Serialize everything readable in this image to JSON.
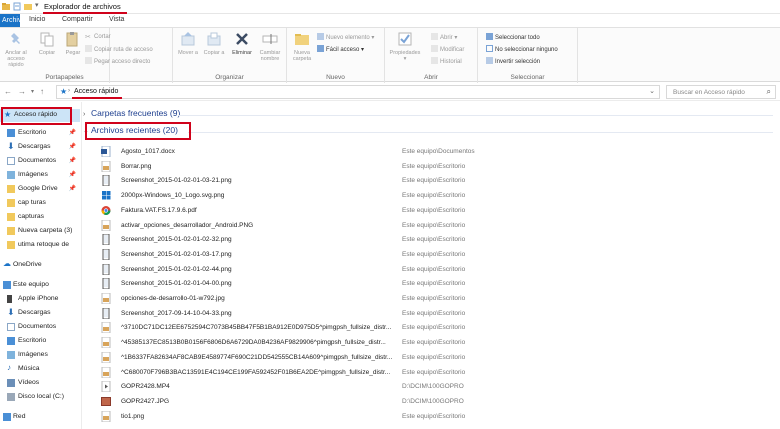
{
  "window": {
    "title": "Explorador de archivos"
  },
  "tabs": [
    "Archivo",
    "Inicio",
    "Compartir",
    "Vista"
  ],
  "ribbon": {
    "portapapeles": {
      "label": "Portapapeles",
      "anclar": "Anclar al acceso rápido",
      "copiar": "Copiar",
      "pegar": "Pegar",
      "cortar": "Cortar",
      "copiar_ruta": "Copiar ruta de acceso",
      "pegar_acceso": "Pegar acceso directo"
    },
    "organizar": {
      "label": "Organizar",
      "mover": "Mover a",
      "copiar_a": "Copiar a",
      "eliminar": "Eliminar",
      "cambiar": "Cambiar nombre"
    },
    "nuevo": {
      "label": "Nuevo",
      "carpeta": "Nueva carpeta",
      "elemento": "Nuevo elemento",
      "facil": "Fácil acceso"
    },
    "abrir": {
      "label": "Abrir",
      "propiedades": "Propiedades",
      "abrir": "Abrir",
      "modificar": "Modificar",
      "historial": "Historial"
    },
    "seleccionar": {
      "label": "Seleccionar",
      "todo": "Seleccionar todo",
      "ninguno": "No seleccionar ninguno",
      "invertir": "Invertir selección"
    }
  },
  "address": {
    "path": "Acceso rápido",
    "search_placeholder": "Buscar en Acceso rápido"
  },
  "nav": {
    "quick_access": "Acceso rápido",
    "items": [
      "Escritorio",
      "Descargas",
      "Documentos",
      "Imágenes",
      "Google Drive",
      "cap turas",
      "capturas",
      "Nueva carpeta (3)",
      "utima retoque de"
    ],
    "onedrive": "OneDrive",
    "este_equipo": "Este equipo",
    "pc_items": [
      "Apple iPhone",
      "Descargas",
      "Documentos",
      "Escritorio",
      "Imágenes",
      "Música",
      "Vídeos",
      "Disco local (C:)"
    ],
    "red": "Red"
  },
  "groups": {
    "frecuentes": "Carpetas frecuentes (9)",
    "recientes": "Archivos recientes (20)"
  },
  "files": [
    {
      "name": "Agosto_1017.docx",
      "path": "Este equipo\\Documentos",
      "icon": "word-doc-icon"
    },
    {
      "name": "Borrar.png",
      "path": "Este equipo\\Escritorio",
      "icon": "image-file-icon"
    },
    {
      "name": "Screenshot_2015-01-02-01-03-21.png",
      "path": "Este equipo\\Escritorio",
      "icon": "phone-screenshot-icon"
    },
    {
      "name": "2000px-Windows_10_Logo.svg.png",
      "path": "Este equipo\\Escritorio",
      "icon": "windows-logo-icon"
    },
    {
      "name": "Faktura.VAT.FS.17.9.6.pdf",
      "path": "Este equipo\\Escritorio",
      "icon": "chrome-pdf-icon"
    },
    {
      "name": "activar_opciones_desarrollador_Android.PNG",
      "path": "Este equipo\\Escritorio",
      "icon": "image-file-icon"
    },
    {
      "name": "Screenshot_2015-01-02-01-02-32.png",
      "path": "Este equipo\\Escritorio",
      "icon": "phone-screenshot-icon"
    },
    {
      "name": "Screenshot_2015-01-02-01-03-17.png",
      "path": "Este equipo\\Escritorio",
      "icon": "phone-screenshot-icon"
    },
    {
      "name": "Screenshot_2015-01-02-01-02-44.png",
      "path": "Este equipo\\Escritorio",
      "icon": "phone-screenshot-icon"
    },
    {
      "name": "Screenshot_2015-01-02-01-04-00.png",
      "path": "Este equipo\\Escritorio",
      "icon": "phone-screenshot-icon"
    },
    {
      "name": "opciones-de-desarrollo-01-w792.jpg",
      "path": "Este equipo\\Escritorio",
      "icon": "image-file-icon"
    },
    {
      "name": "Screenshot_2017-09-14-10-04-33.png",
      "path": "Este equipo\\Escritorio",
      "icon": "phone-screenshot-icon"
    },
    {
      "name": "^3710DC71DC12EE6752594C7073B45BB47F5B1BA912E0D975D5^pimgpsh_fullsize_distr...",
      "path": "Este equipo\\Escritorio",
      "icon": "image-file-icon"
    },
    {
      "name": "^45385137EC8513B0B0156F6806D6A6729DA0B4236AF9829906^pimgpsh_fullsize_distr...",
      "path": "Este equipo\\Escritorio",
      "icon": "image-file-icon"
    },
    {
      "name": "^1B6337FA82634AF8CAB9E4589774F690C21DD542555CB14A609^pimgpsh_fullsize_distr...",
      "path": "Este equipo\\Escritorio",
      "icon": "image-file-icon"
    },
    {
      "name": "^C680070F796B3BAC13591E4C194CE199FA592452F01B6EA2DE^pimgpsh_fullsize_distr...",
      "path": "Este equipo\\Escritorio",
      "icon": "image-file-icon"
    },
    {
      "name": "GOPR2428.MP4",
      "path": "D:\\DCIM\\100GOPRO",
      "icon": "video-file-icon"
    },
    {
      "name": "GOPR2427.JPG",
      "path": "D:\\DCIM\\100GOPRO",
      "icon": "photo-file-icon"
    },
    {
      "name": "tio1.png",
      "path": "Este equipo\\Escritorio",
      "icon": "image-file-icon"
    }
  ],
  "colors": {
    "accent": "#1a73c7",
    "highlight": "#d0021b",
    "group_header": "#1e3f8f"
  }
}
